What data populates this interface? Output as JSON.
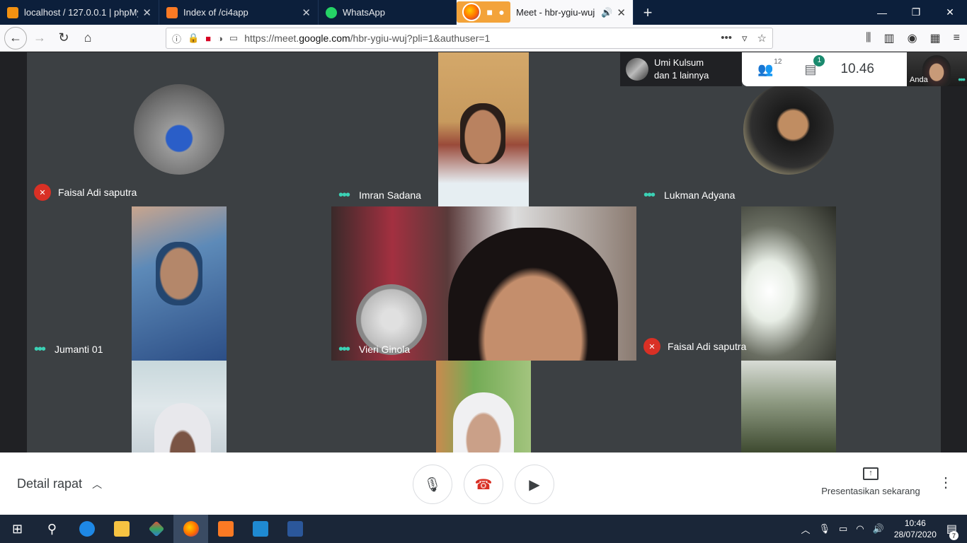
{
  "browser": {
    "tabs": [
      {
        "title": "localhost / 127.0.0.1 | phpMyAdmin",
        "icon": "phpmyadmin-icon",
        "color": "#f29111"
      },
      {
        "title": "Index of /ci4app",
        "icon": "xampp-icon",
        "color": "#fb7a24"
      },
      {
        "title": "WhatsApp",
        "icon": "whatsapp-icon",
        "color": "#25d366"
      },
      {
        "title": "Meet - hbr-ygiu-wuj",
        "icon": "meet-icon",
        "color": "#00897b"
      }
    ],
    "new_tab": "+",
    "url_prefix": "https://meet.",
    "url_host": "google.com",
    "url_rest": "/hbr-ygiu-wuj?pli=1&authuser=1"
  },
  "meet": {
    "tiles": [
      {
        "name": "Faisal Adi saputra",
        "status": "muted"
      },
      {
        "name": "Imran Sadana",
        "status": "speaking"
      },
      {
        "name": "Lukman Adyana",
        "status": "speaking"
      },
      {
        "name": "Jumanti 01",
        "status": "speaking"
      },
      {
        "name": "Vieri Ginola",
        "status": "speaking"
      },
      {
        "name": "Faisal Adi saputra",
        "status": "muted"
      },
      {
        "name": "",
        "status": "none"
      },
      {
        "name": "",
        "status": "none"
      },
      {
        "name": "",
        "status": "none"
      }
    ],
    "top_info": {
      "line1": "Umi Kulsum",
      "line2": "dan 1 lainnya"
    },
    "participants_count": "12",
    "chat_badge": "1",
    "clock": "10.46",
    "self_label": "Anda",
    "accent": "#3bd1b5",
    "mute_color": "#d93025"
  },
  "bottom": {
    "details_label": "Detail rapat",
    "present_label": "Presentasikan sekarang"
  },
  "taskbar": {
    "time": "10:46",
    "date": "28/07/2020",
    "notifications": "7"
  }
}
